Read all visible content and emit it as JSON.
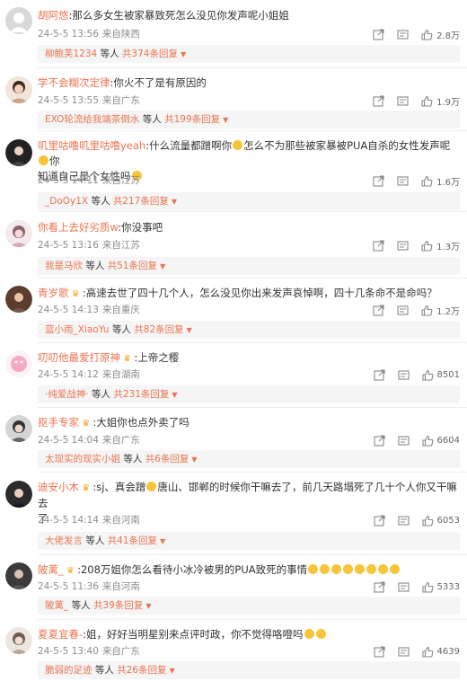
{
  "comments": [
    {
      "username": "胡阿悠",
      "content": ":那么多女生被家暴致死怎么没见你发声呢小姐姐",
      "date": "24-5-5 13:56",
      "location": "来自陕西",
      "likes": "2.8万",
      "reply_user": "柳鲍芙1234",
      "reply_mid": "等人",
      "reply_total": "共374条回复"
    },
    {
      "username": "学不会糊次定律",
      "content": ":你火不了是有原因的",
      "date": "24-5-5 13:55",
      "location": "来自广东",
      "likes": "1.9万",
      "reply_user": "EXO轮流给我端茶倒水",
      "reply_mid": "等人",
      "reply_total": "共199条回复"
    },
    {
      "username": "叽里咕噜叽里咕噜yeah",
      "content": ":什么流量都蹭啊你",
      "content_b": "怎么不为那些被家暴被PUA自杀的女性发声呢",
      "content_c": "你",
      "content_line2": "知道自己是个女性吗",
      "date": "24-5-5 14:11",
      "location": "来自江苏",
      "likes": "1.6万",
      "reply_user": "_DoOy1X",
      "reply_mid": "等人",
      "reply_total": "共217条回复"
    },
    {
      "username": "你看上去好劣质w",
      "content": ":你没事吧",
      "date": "24-5-5 13:16",
      "location": "来自江苏",
      "likes": "1.3万",
      "reply_user": "我是马欣",
      "reply_mid": "等人",
      "reply_total": "共51条回复"
    },
    {
      "username": "青岁歌",
      "content": ":高速去世了四十几个人，怎么没见你出来发声哀悼啊，四十几条命不是命吗？",
      "date": "24-5-5 14:13",
      "location": "来自重庆",
      "likes": "1.2万",
      "reply_user": "蓝小雨_XiaoYu",
      "reply_mid": "等人",
      "reply_total": "共82条回复"
    },
    {
      "username": "叨叨他最爱打原神",
      "content": ":上帝之樱",
      "date": "24-5-5 14:12",
      "location": "来自湖南",
      "likes": "8501",
      "reply_user": "·纯爱战神·",
      "reply_mid": "等人",
      "reply_total": "共231条回复"
    },
    {
      "username": "抠手专家",
      "content": ":大姐你也点外卖了吗",
      "date": "24-5-5 14:04",
      "location": "来自广东",
      "likes": "6604",
      "reply_user": "太现实的现实小姐",
      "reply_mid": "等人",
      "reply_total": "共6条回复"
    },
    {
      "username": "迪安小木",
      "content": ":sj、真会蹭",
      "content_b": "唐山、邯郸的时候你干嘛去了，前几天路塌死了几十个人你又干嘛去",
      "content_line2": "了",
      "date": "24-5-5 14:14",
      "location": "来自河南",
      "likes": "6053",
      "reply_user": "大佬发言",
      "reply_mid": "等人",
      "reply_total": "共41条回复"
    },
    {
      "username": "陂蓠_",
      "content": ":208万姐你怎么看待小冰冷被男的PUA致死的事情",
      "date": "24-5-5 11:36",
      "location": "来自河南",
      "likes": "5333",
      "reply_user": "陂蓠_",
      "reply_mid": "等人",
      "reply_total": "共39条回复"
    },
    {
      "username": "夏夏宜春-",
      "content": ":姐，好好当明星别来点评时政，你不觉得咯噔吗",
      "date": "24-5-5 13:40",
      "location": "来自广东",
      "likes": "4639",
      "reply_user": "脆弱的足迹",
      "reply_mid": "等人",
      "reply_total": "共26条回复"
    }
  ],
  "icons": {
    "share": "share-icon",
    "comment": "comment-icon",
    "like": "thumbs-up-icon",
    "badge": "crown-badge-icon",
    "expand": "caret-down-icon"
  },
  "colors": {
    "username": "#eb7350",
    "meta": "#8c8c8c",
    "reply_bg": "#f5f5f5",
    "emoji": "#f7c53a"
  }
}
